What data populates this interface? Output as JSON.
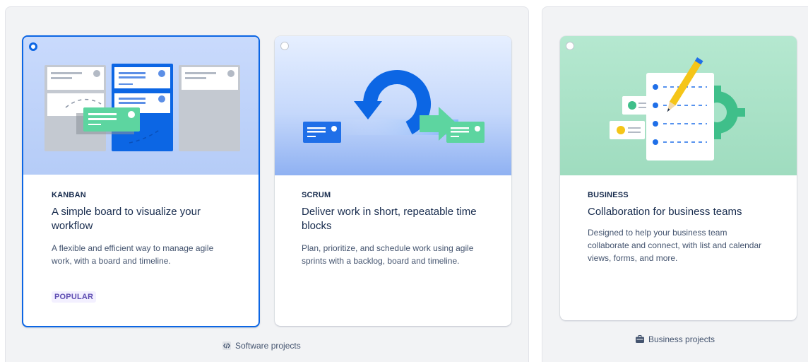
{
  "groups": {
    "software": {
      "label": "Software projects",
      "icon": "code-icon",
      "cards": [
        {
          "id": "kanban",
          "eyebrow": "KANBAN",
          "title": "A simple board to visualize your workflow",
          "description": "A flexible and efficient way to manage agile work, with a board and timeline.",
          "badge": "POPULAR",
          "selected": true
        },
        {
          "id": "scrum",
          "eyebrow": "SCRUM",
          "title": "Deliver work in short, repeatable time blocks",
          "description": "Plan, prioritize, and schedule work using agile sprints with a backlog, board and timeline.",
          "selected": false
        }
      ]
    },
    "business": {
      "label": "Business projects",
      "icon": "briefcase-icon",
      "cards": [
        {
          "id": "business",
          "eyebrow": "BUSINESS",
          "title": "Collaboration for business teams",
          "description": "Designed to help your business team collaborate and connect, with list and calendar views, forms, and more.",
          "selected": false
        }
      ]
    }
  },
  "colors": {
    "selected_border": "#0c66e4",
    "badge_bg": "#f3f0ff",
    "badge_text": "#5e4db2",
    "group_bg": "#f2f3f5"
  }
}
